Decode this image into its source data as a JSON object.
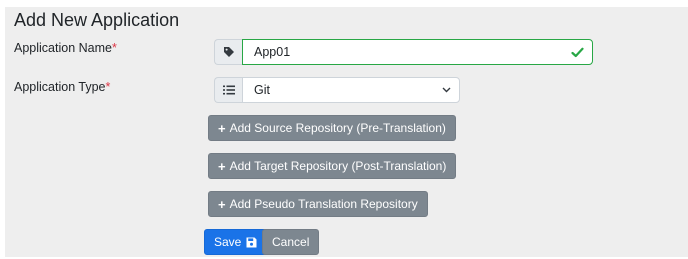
{
  "form": {
    "title": "Add New Application",
    "app_name_label": "Application Name",
    "app_type_label": "Application Type",
    "required_mark": "*",
    "app_name_value": "App01",
    "app_type_value": "Git",
    "buttons": {
      "add_source": "Add Source Repository (Pre-Translation)",
      "add_target": "Add Target Repository (Post-Translation)",
      "add_pseudo": "Add Pseudo Translation Repository",
      "plus": "+",
      "save": "Save",
      "cancel": "Cancel"
    }
  },
  "icons": {
    "name_addon": "tag-icon",
    "type_addon": "list-icon",
    "valid": "check-icon",
    "select": "chevron-down-icon",
    "save": "floppy-disk-icon"
  },
  "colors": {
    "panel_bg": "#eeeeee",
    "required": "#dc3545",
    "valid_border": "#28a745",
    "secondary_button": "#7d8790",
    "primary_button": "#1a73e8"
  }
}
